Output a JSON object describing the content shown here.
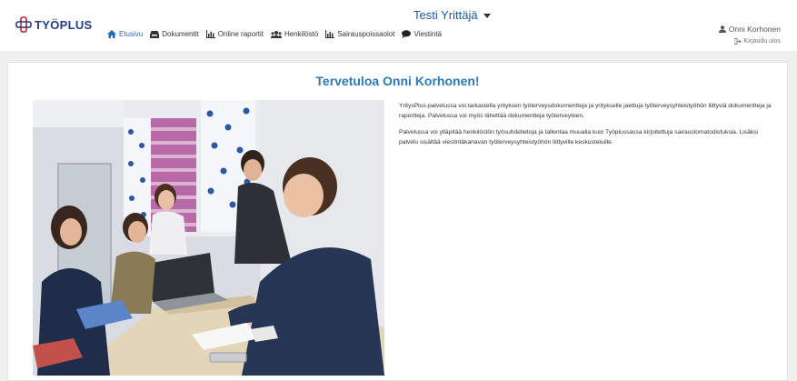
{
  "header": {
    "logo_text": "TYÖPLUS",
    "company_name": "Testi Yrittäjä",
    "nav": [
      {
        "label": "Etusivu",
        "icon": "home-icon",
        "active": true
      },
      {
        "label": "Dokumentit",
        "icon": "inbox-icon",
        "active": false
      },
      {
        "label": "Online raportit",
        "icon": "chart-icon",
        "active": false
      },
      {
        "label": "Henkilöstö",
        "icon": "users-icon",
        "active": false
      },
      {
        "label": "Sairauspoissaolot",
        "icon": "chart-icon",
        "active": false
      },
      {
        "label": "Viestintä",
        "icon": "comment-icon",
        "active": false
      }
    ],
    "user_name": "Onni Korhonen",
    "logout_label": "Kirjaudu ulos"
  },
  "main": {
    "welcome_title": "Tervetuloa Onni Korhonen!",
    "paragraphs": [
      "YritysPlus-palvelussa voi tarkastella yrityksen työterveysdokumentteja ja yritykselle jaettuja työterveysyhteistyöhön liittyviä dokumentteja ja raportteja. Palvelussa voi myös lähettää dokumentteja työterveyteen.",
      "Palvelussa voi ylläpitää henkilöstön työsuhdetietoja ja tallentaa muualla kuin Työplussassa kirjoitettuja sairauslomatodistuksia. Lisäksi palvelu sisältää viestintäkanavan työterveysyhteistyöhön liittyville keskusteluille."
    ]
  },
  "colors": {
    "brand_blue": "#1f3f86",
    "title_blue": "#2a7ab9",
    "nav_active": "#1f6bbf"
  }
}
